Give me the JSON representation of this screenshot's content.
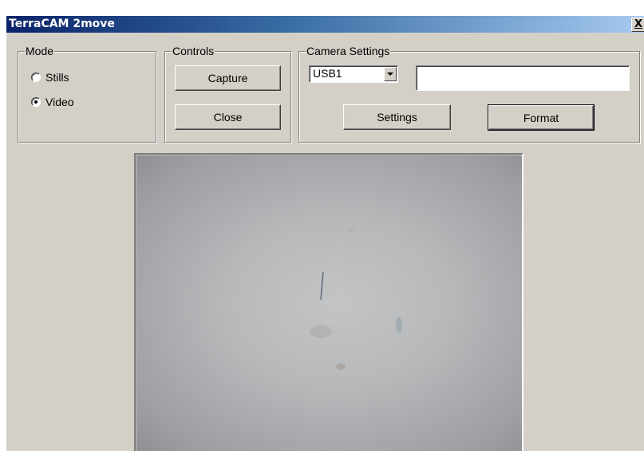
{
  "window": {
    "title": "TerraCAM 2move",
    "close_label": "X"
  },
  "mode": {
    "legend": "Mode",
    "options": [
      {
        "label": "Stills",
        "checked": false
      },
      {
        "label": "Video",
        "checked": true
      }
    ]
  },
  "controls": {
    "legend": "Controls",
    "capture_label": "Capture",
    "close_label": "Close"
  },
  "camera_settings": {
    "legend": "Camera Settings",
    "device_selected": "USB1",
    "text_value": "",
    "settings_label": "Settings",
    "format_label": "Format"
  },
  "preview": {
    "icon": "camera-preview-image"
  }
}
